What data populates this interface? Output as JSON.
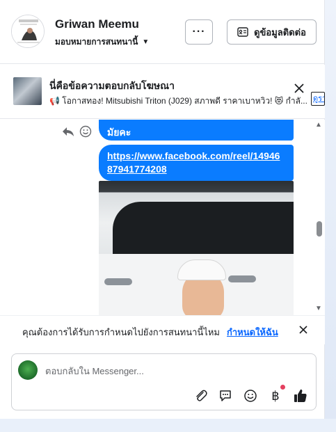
{
  "header": {
    "contact_name": "Griwan Meemu",
    "assign_label": "มอบหมายการสนทนานี้",
    "more_label": "···",
    "contact_info_label": "ดูข้อมูลติดต่อ"
  },
  "ad_reply": {
    "title": "นี่คือข้อความตอบกลับโฆษณา",
    "text": "📢 โอกาสทอง! Mitsubishi Triton (J029) สภาพดี ราคาเบาหวิว! 😻 กำลั...",
    "view_link": "ดูรา"
  },
  "messages": {
    "partial_text": "มัยคะ",
    "link_text": "https://www.facebook.com/reel/1494687941774208"
  },
  "reminder": {
    "text": "คุณต้องการได้รับการกำหนดไปยังการสนทนานี้ไหม",
    "link": "กำหนดให้ฉัน"
  },
  "composer": {
    "placeholder": "ตอบกลับใน Messenger...",
    "baht_symbol": "฿"
  },
  "colors": {
    "bubble": "#0a7cff",
    "link": "#0866ff"
  }
}
